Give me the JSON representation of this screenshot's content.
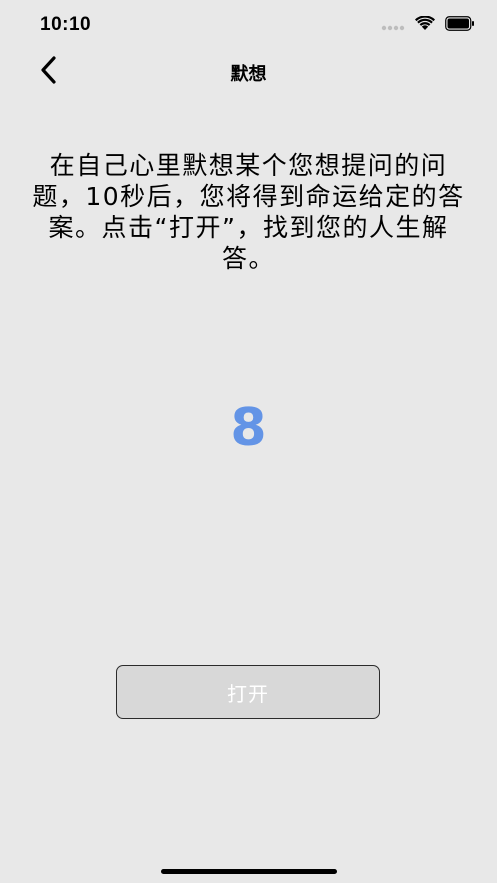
{
  "status_bar": {
    "time": "10:10",
    "icons": [
      "cellular-dots-icon",
      "wifi-icon",
      "battery-icon"
    ]
  },
  "nav": {
    "back_icon": "chevron-left-icon",
    "title": "默想"
  },
  "instructions": {
    "text": "在自己心里默想某个您想提问的问题，10秒后，您将得到命运给定的答案。点击“打开”，找到您的人生解答。"
  },
  "countdown": {
    "value": "8",
    "color": "#6394e6"
  },
  "open_button": {
    "label": "打开"
  }
}
